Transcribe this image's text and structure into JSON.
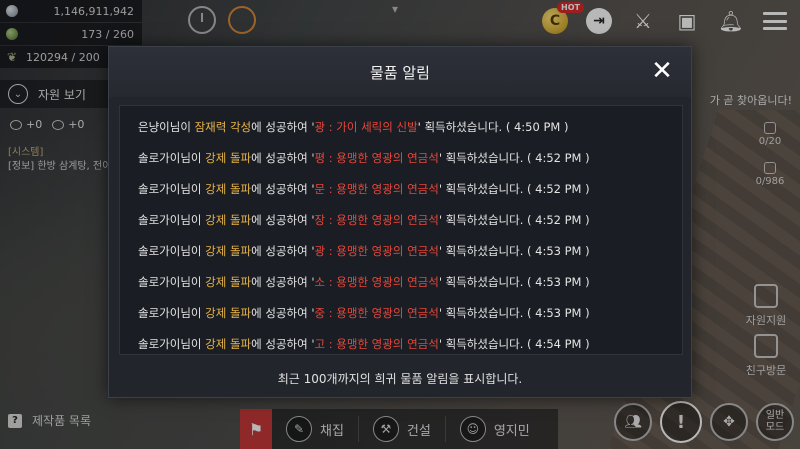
{
  "colors": {
    "skill_highlight": "#e9b649",
    "item_highlight": "#e5473b",
    "modal_bg": "#22252c",
    "hot_badge": "#d62b2b"
  },
  "resources": {
    "silver": "1,146,911,942",
    "energy": "173 / 260",
    "storage": "120294 / 200",
    "toggle_label": "자원 보기",
    "plus_a": "+0",
    "plus_b": "+0",
    "system_tag": "[시스템]",
    "system_line": "[정보] 한방 삼계탕, 전이"
  },
  "top_right": {
    "hot_badge": "HOT",
    "coin_letter": "C",
    "note_prefix": "",
    "note_highlight": "",
    "note_text": "가 곧 찾아옵니다!",
    "stat_1": "0/20",
    "stat_2": "0/986",
    "side_1": "자원지원",
    "side_2": "친구방문"
  },
  "modal": {
    "title": "물품 알림",
    "close_icon": "close-icon",
    "footer": "최근 100개까지의 희귀 물품 알림을 표시합니다.",
    "messages": [
      {
        "user": "은냥이",
        "pre": "님이 ",
        "skill": "잠재력 각성",
        "mid": "에 성공하여 '",
        "item": "광 : 가이 세릭의 신발",
        "post": "' 획득하셨습니다. ( 4:50 PM )"
      },
      {
        "user": "솔로가이",
        "pre": "님이 ",
        "skill": "강제 돌파",
        "mid": "에 성공하여 '",
        "item": "평 : 용맹한 영광의 연금석",
        "post": "' 획득하셨습니다. ( 4:52 PM )"
      },
      {
        "user": "솔로가이",
        "pre": "님이 ",
        "skill": "강제 돌파",
        "mid": "에 성공하여 '",
        "item": "문 : 용맹한 영광의 연금석",
        "post": "' 획득하셨습니다. ( 4:52 PM )"
      },
      {
        "user": "솔로가이",
        "pre": "님이 ",
        "skill": "강제 돌파",
        "mid": "에 성공하여 '",
        "item": "장 : 용맹한 영광의 연금석",
        "post": "' 획득하셨습니다. ( 4:52 PM )"
      },
      {
        "user": "솔로가이",
        "pre": "님이 ",
        "skill": "강제 돌파",
        "mid": "에 성공하여 '",
        "item": "광 : 용맹한 영광의 연금석",
        "post": "' 획득하셨습니다. ( 4:53 PM )"
      },
      {
        "user": "솔로가이",
        "pre": "님이 ",
        "skill": "강제 돌파",
        "mid": "에 성공하여 '",
        "item": "소 : 용맹한 영광의 연금석",
        "post": "' 획득하셨습니다. ( 4:53 PM )"
      },
      {
        "user": "솔로가이",
        "pre": "님이 ",
        "skill": "강제 돌파",
        "mid": "에 성공하여 '",
        "item": "중 : 용맹한 영광의 연금석",
        "post": "' 획득하셨습니다. ( 4:53 PM )"
      },
      {
        "user": "솔로가이",
        "pre": "님이 ",
        "skill": "강제 돌파",
        "mid": "에 성공하여 '",
        "item": "고 : 용맹한 영광의 연금석",
        "post": "' 획득하셨습니다. ( 4:54 PM )"
      }
    ]
  },
  "bottom": {
    "crafting_list": "제작품 목록",
    "nav": [
      "채집",
      "건설",
      "영지민"
    ],
    "mode": "일반\n모드",
    "mode_line1": "일반",
    "mode_line2": "모드"
  }
}
